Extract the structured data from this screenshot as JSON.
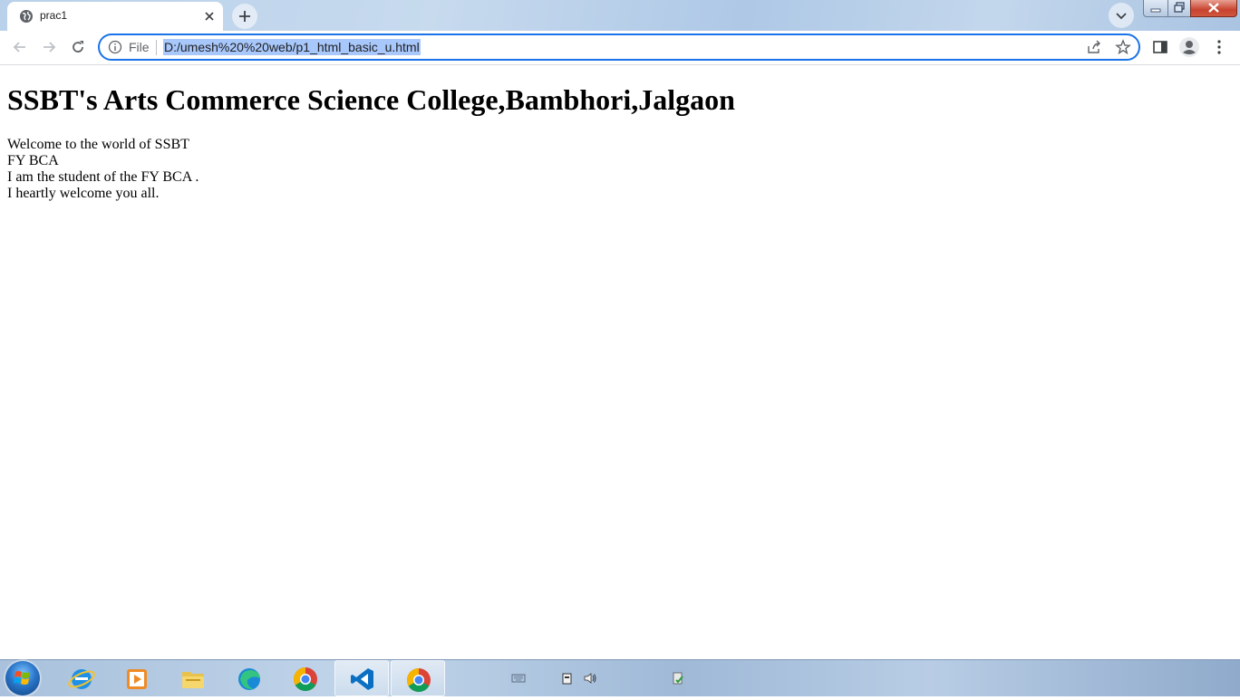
{
  "browser": {
    "tab": {
      "title": "prac1",
      "favicon": "globe-icon"
    },
    "new_tab_icon": "plus-icon",
    "tab_search_icon": "chevron-down-icon",
    "window_controls": [
      "minimize",
      "maximize",
      "close"
    ]
  },
  "toolbar": {
    "back_icon": "arrow-left-icon",
    "forward_icon": "arrow-right-icon",
    "reload_icon": "reload-icon",
    "omnibox": {
      "scheme_label": "File",
      "url": "D:/umesh%20%20web/p1_html_basic_u.html",
      "selected": true
    },
    "actions": [
      "share-icon",
      "star-icon",
      "side-panel-icon",
      "profile-icon",
      "menu-icon"
    ]
  },
  "page": {
    "heading": "SSBT's Arts Commerce Science College,Bambhori,Jalgaon",
    "lines": [
      "Welcome to the world of SSBT",
      "FY BCA",
      "I am the student of the FY BCA .",
      "I heartly welcome you all."
    ]
  },
  "taskbar": {
    "items": [
      "internet-explorer-icon",
      "media-player-icon",
      "file-explorer-icon",
      "edge-icon",
      "chrome-icon",
      "vscode-icon",
      "chrome-icon"
    ],
    "active_item": "chrome-icon",
    "tray": [
      "keyboard-icon",
      "network-icon",
      "volume-icon",
      "action-center-icon"
    ]
  },
  "colors": {
    "accent": "#1a73e8",
    "selection": "#a8c7fa",
    "titlebar": "#b9d1ea"
  }
}
